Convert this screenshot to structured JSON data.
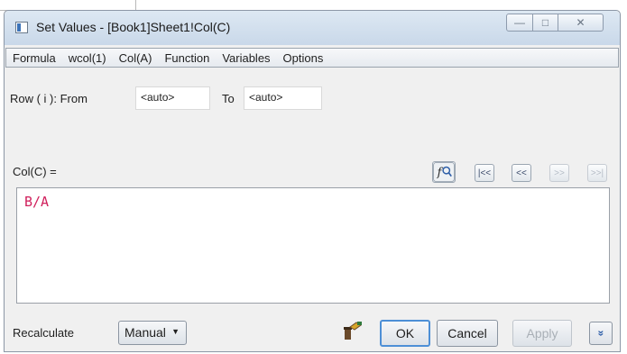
{
  "window": {
    "title": "Set Values - [Book1]Sheet1!Col(C)"
  },
  "titlebar_controls": {
    "minimize": "—",
    "maximize": "□",
    "close": "✕"
  },
  "menu": [
    "Formula",
    "wcol(1)",
    "Col(A)",
    "Function",
    "Variables",
    "Options"
  ],
  "row": {
    "label": "Row ( i ):  From",
    "from_value": "<auto>",
    "to_label": "To",
    "to_value": "<auto>"
  },
  "expression": {
    "label": "Col(C) =",
    "formula": "B/A"
  },
  "nav_buttons": {
    "first": "|<<",
    "prev": "<<",
    "next": ">>",
    "last": ">>|"
  },
  "bottom": {
    "recalculate_label": "Recalculate",
    "recalculate_value": "Manual",
    "ok_label": "OK",
    "cancel_label": "Cancel",
    "apply_label": "Apply",
    "expand_label": "»"
  },
  "colors": {
    "formula_text": "#d0205c",
    "accent": "#4d8fd6"
  }
}
